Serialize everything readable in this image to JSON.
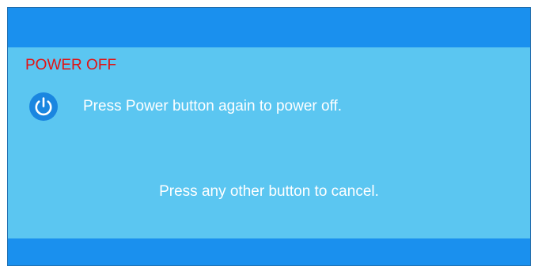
{
  "dialog": {
    "title": "POWER OFF",
    "message": "Press Power button again to power off.",
    "cancel_hint": "Press any other button to cancel.",
    "icon": "power-icon"
  },
  "colors": {
    "bar": "#1a90ee",
    "body": "#5bc6f1",
    "title": "#e31212",
    "text": "#ffffff"
  }
}
